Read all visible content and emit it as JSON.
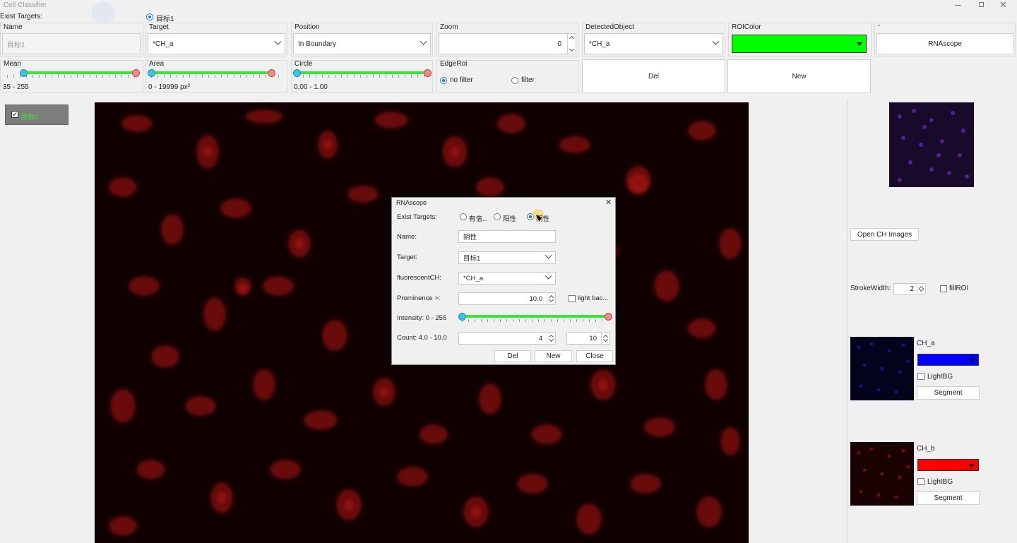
{
  "window": {
    "title": "Cell Classifier"
  },
  "exist_targets": {
    "label": "Exist Targets:",
    "options": [
      "目标1"
    ],
    "selected": "目标1"
  },
  "top_controls": {
    "name": {
      "label": "Name",
      "value": "目标1"
    },
    "target": {
      "label": "Target",
      "value": "*CH_a"
    },
    "position": {
      "label": "Position",
      "value": "In Boundary"
    },
    "zoom": {
      "label": "Zoom",
      "value": "0"
    },
    "detected_object": {
      "label": "DetectedObject",
      "value": "*CH_a"
    },
    "roi_color": {
      "label": "ROIColor",
      "color": "#00ff00"
    },
    "rnascope": {
      "label": "-",
      "button": "RNAscope"
    }
  },
  "filters": {
    "mean": {
      "label": "Mean",
      "range_text": "35 - 255",
      "low": 35,
      "high": 255,
      "min": 0,
      "max": 255
    },
    "area": {
      "label": "Area",
      "range_text": "0 - 19999 px²",
      "low": 0,
      "high": 19999,
      "max": 22000
    },
    "circle": {
      "label": "Circle",
      "range_text": "0.00 - 1.00",
      "low": 0.0,
      "high": 1.0
    },
    "edge_roi": {
      "label": "EdgeRoi",
      "options": [
        "no filter",
        "filter"
      ],
      "selected": "no filter"
    },
    "del_button": "Del",
    "new_button": "New"
  },
  "target_list": [
    {
      "label": "目标1",
      "checked": true
    }
  ],
  "right_panel": {
    "open_ch_button": "Open CH Images",
    "stroke_width_label": "StrokeWidth:",
    "stroke_width": "2",
    "fill_roi_label": "fillROI",
    "channels": [
      {
        "name": "CH_a",
        "color": "#0000ff",
        "light_bg_label": "LightBG",
        "segment_button": "Segment"
      },
      {
        "name": "CH_b",
        "color": "#ff0000",
        "light_bg_label": "LightBG",
        "segment_button": "Segment"
      }
    ]
  },
  "dialog": {
    "title": "RNAscope",
    "close_icon": "close-icon",
    "exist_targets_label": "Exist Targets:",
    "targets": [
      "有信...",
      "阳性",
      "阴性"
    ],
    "selected_target": "阴性",
    "name_label": "Name:",
    "name_value": "阴性",
    "target_label": "Target:",
    "target_value": "目标1",
    "fluorescent_label": "fluorescentCH:",
    "fluorescent_value": "*CH_a",
    "prominence_label": "Prominence >:",
    "prominence_value": "10.0",
    "light_bg_label": "light bac...",
    "intensity_label": "Intensity: 0 - 255",
    "intensity_low": 0,
    "intensity_high": 255,
    "count_label": "Count: 4.0 - 10.0",
    "count_min": "4",
    "count_max": "10",
    "del_button": "Del",
    "new_button": "New",
    "close_button": "Close"
  }
}
